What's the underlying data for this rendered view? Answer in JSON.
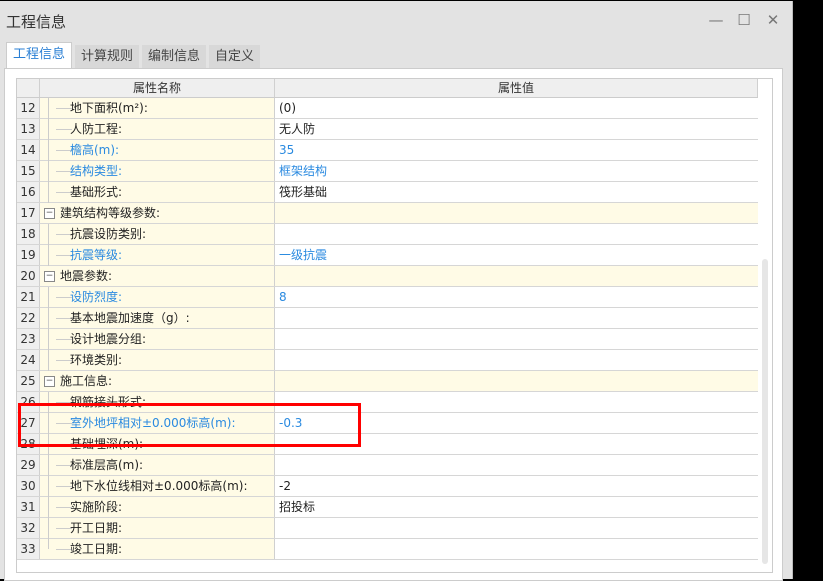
{
  "window": {
    "title": "工程信息",
    "minimize": "—",
    "maximize": "☐",
    "close": "✕"
  },
  "tabs": [
    {
      "label": "工程信息",
      "active": true
    },
    {
      "label": "计算规则"
    },
    {
      "label": "编制信息"
    },
    {
      "label": "自定义"
    }
  ],
  "table": {
    "headers": {
      "name": "属性名称",
      "value": "属性值"
    },
    "rows": [
      {
        "num": "12",
        "name": "地下面积(m²):",
        "value": "(0)",
        "type": "child",
        "blue": false
      },
      {
        "num": "13",
        "name": "人防工程:",
        "value": "无人防",
        "type": "child",
        "blue": false
      },
      {
        "num": "14",
        "name": "檐高(m):",
        "value": "35",
        "type": "child",
        "blue": true
      },
      {
        "num": "15",
        "name": "结构类型:",
        "value": "框架结构",
        "type": "child",
        "blue": true
      },
      {
        "num": "16",
        "name": "基础形式:",
        "value": "筏形基础",
        "type": "child",
        "blue": false
      },
      {
        "num": "17",
        "name": "建筑结构等级参数:",
        "value": "",
        "type": "group",
        "blue": false
      },
      {
        "num": "18",
        "name": "抗震设防类别:",
        "value": "",
        "type": "child",
        "blue": false
      },
      {
        "num": "19",
        "name": "抗震等级:",
        "value": "一级抗震",
        "type": "child",
        "blue": true
      },
      {
        "num": "20",
        "name": "地震参数:",
        "value": "",
        "type": "group",
        "blue": false
      },
      {
        "num": "21",
        "name": "设防烈度:",
        "value": "8",
        "type": "child",
        "blue": true
      },
      {
        "num": "22",
        "name": "基本地震加速度（g）:",
        "value": "",
        "type": "child",
        "blue": false
      },
      {
        "num": "23",
        "name": "设计地震分组:",
        "value": "",
        "type": "child",
        "blue": false
      },
      {
        "num": "24",
        "name": "环境类别:",
        "value": "",
        "type": "child",
        "blue": false
      },
      {
        "num": "25",
        "name": "施工信息:",
        "value": "",
        "type": "group",
        "blue": false
      },
      {
        "num": "26",
        "name": "钢筋接头形式:",
        "value": "",
        "type": "child",
        "blue": false
      },
      {
        "num": "27",
        "name": "室外地坪相对±0.000标高(m):",
        "value": "-0.3",
        "type": "child",
        "blue": true
      },
      {
        "num": "28",
        "name": "基础埋深(m):",
        "value": "",
        "type": "child",
        "blue": false
      },
      {
        "num": "29",
        "name": "标准层高(m):",
        "value": "",
        "type": "child",
        "blue": false
      },
      {
        "num": "30",
        "name": "地下水位线相对±0.000标高(m):",
        "value": "-2",
        "type": "child",
        "blue": false
      },
      {
        "num": "31",
        "name": "实施阶段:",
        "value": "招投标",
        "type": "child",
        "blue": false
      },
      {
        "num": "32",
        "name": "开工日期:",
        "value": "",
        "type": "child",
        "blue": false
      },
      {
        "num": "33",
        "name": "竣工日期:",
        "value": "",
        "type": "child",
        "blue": false
      }
    ]
  },
  "collapse_symbol": "−"
}
